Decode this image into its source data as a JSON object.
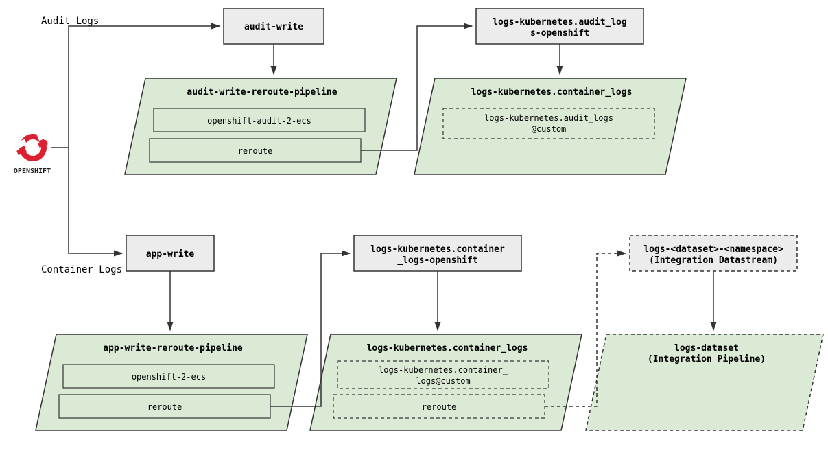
{
  "labels": {
    "audit": "Audit Logs",
    "container": "Container Logs",
    "openshift": "OPENSHIFT"
  },
  "boxes": {
    "audit_write": "audit-write",
    "audit_ds_l1": "logs-kubernetes.audit_log",
    "audit_ds_l2": "s-openshift",
    "app_write": "app-write",
    "cont_ds_l1": "logs-kubernetes.container",
    "cont_ds_l2": "_logs-openshift",
    "int_ds_l1": "logs-<dataset>-<namespace>",
    "int_ds_l2": "(Integration Datastream)"
  },
  "para": {
    "audit_pipe": {
      "title": "audit-write-reroute-pipeline",
      "p1": "openshift-audit-2-ecs",
      "p2": "reroute"
    },
    "audit_cont": {
      "title": "logs-kubernetes.container_logs",
      "p1_l1": "logs-kubernetes.audit_logs",
      "p1_l2": "@custom"
    },
    "app_pipe": {
      "title": "app-write-reroute-pipeline",
      "p1": "openshift-2-ecs",
      "p2": "reroute"
    },
    "cont_cont": {
      "title": "logs-kubernetes.container_logs",
      "p1_l1": "logs-kubernetes.container_",
      "p1_l2": "logs@custom",
      "p2": "reroute"
    },
    "int_pipe": {
      "title_l1": "logs-dataset",
      "title_l2": "(Integration Pipeline)"
    }
  }
}
